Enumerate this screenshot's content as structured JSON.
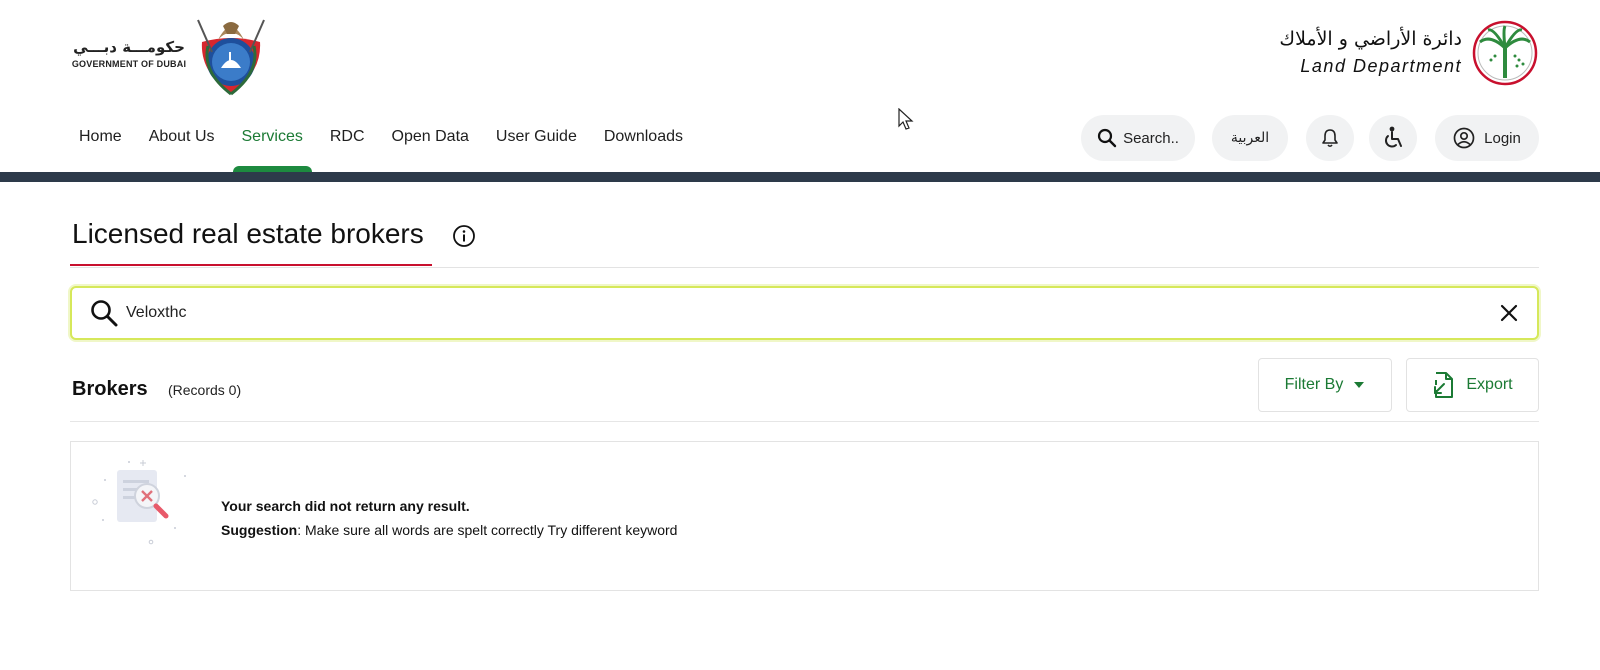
{
  "header": {
    "gov_logo": {
      "arabic": "حكومـــة دبـــي",
      "english": "GOVERNMENT OF DUBAI"
    },
    "dld_logo": {
      "arabic": "دائرة الأراضي و الأملاك",
      "english": "Land Department"
    },
    "nav": [
      {
        "label": "Home",
        "active": false
      },
      {
        "label": "About Us",
        "active": false
      },
      {
        "label": "Services",
        "active": true
      },
      {
        "label": "RDC",
        "active": false
      },
      {
        "label": "Open Data",
        "active": false
      },
      {
        "label": "User Guide",
        "active": false
      },
      {
        "label": "Downloads",
        "active": false
      }
    ],
    "utilities": {
      "search_label": "Search..",
      "language_label": "العربية",
      "login_label": "Login"
    }
  },
  "main": {
    "page_title": "Licensed real estate brokers",
    "search": {
      "value": "Veloxthc"
    },
    "brokers": {
      "title": "Brokers",
      "records": "(Records 0)",
      "filter_label": "Filter By",
      "export_label": "Export"
    },
    "empty_state": {
      "title": "Your search did not return any result.",
      "suggestion_label": "Suggestion",
      "suggestion_text": ": Make sure all words are spelt correctly Try different keyword"
    }
  },
  "colors": {
    "accent_green": "#1b7a34",
    "title_underline_red": "#c8102e",
    "band_navy": "#2d3a4a",
    "search_focus": "#d6e85a"
  }
}
